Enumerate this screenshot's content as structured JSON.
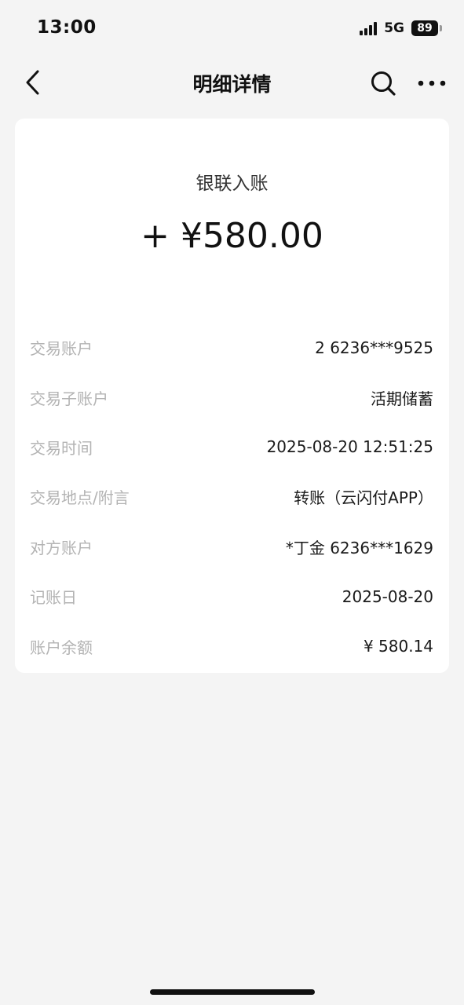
{
  "status_bar": {
    "time": "13:00",
    "network": "5G",
    "battery": "89",
    "icons": [
      "signal-icon",
      "battery-icon"
    ]
  },
  "nav": {
    "title": "明细详情",
    "icons": [
      "back-icon",
      "search-icon",
      "more-icon"
    ]
  },
  "transaction": {
    "type": "银联入账",
    "amount": "+ ¥580.00"
  },
  "details": [
    {
      "label": "交易账户",
      "value": "2 6236***9525"
    },
    {
      "label": "交易子账户",
      "value": "活期储蓄"
    },
    {
      "label": "交易时间",
      "value": "2025-08-20 12:51:25"
    },
    {
      "label": "交易地点/附言",
      "value": "转账（云闪付APP）"
    },
    {
      "label": "对方账户",
      "value": "*丁金 6236***1629"
    },
    {
      "label": "记账日",
      "value": "2025-08-20"
    },
    {
      "label": "账户余额",
      "value": "¥ 580.14"
    }
  ],
  "colors": {
    "background": "#f4f4f4",
    "card": "#ffffff",
    "label": "#b3b3b3",
    "text": "#111111"
  }
}
